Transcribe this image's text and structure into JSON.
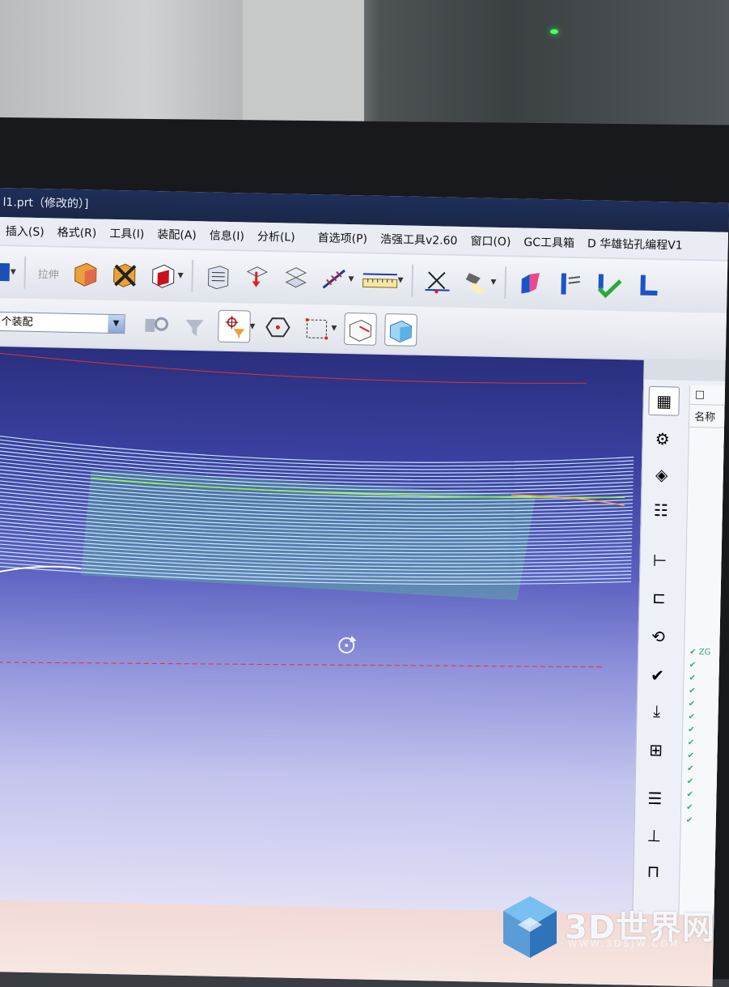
{
  "window": {
    "title": "l1.prt（修改的）]"
  },
  "menu": [
    "插入(S)",
    "格式(R)",
    "工具(I)",
    "装配(A)",
    "信息(I)",
    "分析(L)",
    "首选项(P)",
    "浩强工具v2.60",
    "窗口(O)",
    "GC工具箱",
    "D 华雄钻孔编程V1"
  ],
  "toolbar1": {
    "extrude_label": "拉伸"
  },
  "toolbar2": {
    "assembly_select_value": "个装配"
  },
  "navigator": {
    "header_icon": "□",
    "column_name": "名称"
  },
  "tree_items": [
    "ZG",
    "",
    "",
    "",
    "",
    "",
    "",
    "",
    "",
    "",
    "",
    "",
    "",
    ""
  ],
  "watermark": {
    "brand": "3D世界网",
    "url": "WWW.3DSJW.COM"
  },
  "colors": {
    "viewport_top": "#2a2f7e",
    "viewport_bottom": "#e4e2f6",
    "toolpath": "#d6f6ff",
    "accent_red": "#d33",
    "check_green": "#2aa83a"
  }
}
